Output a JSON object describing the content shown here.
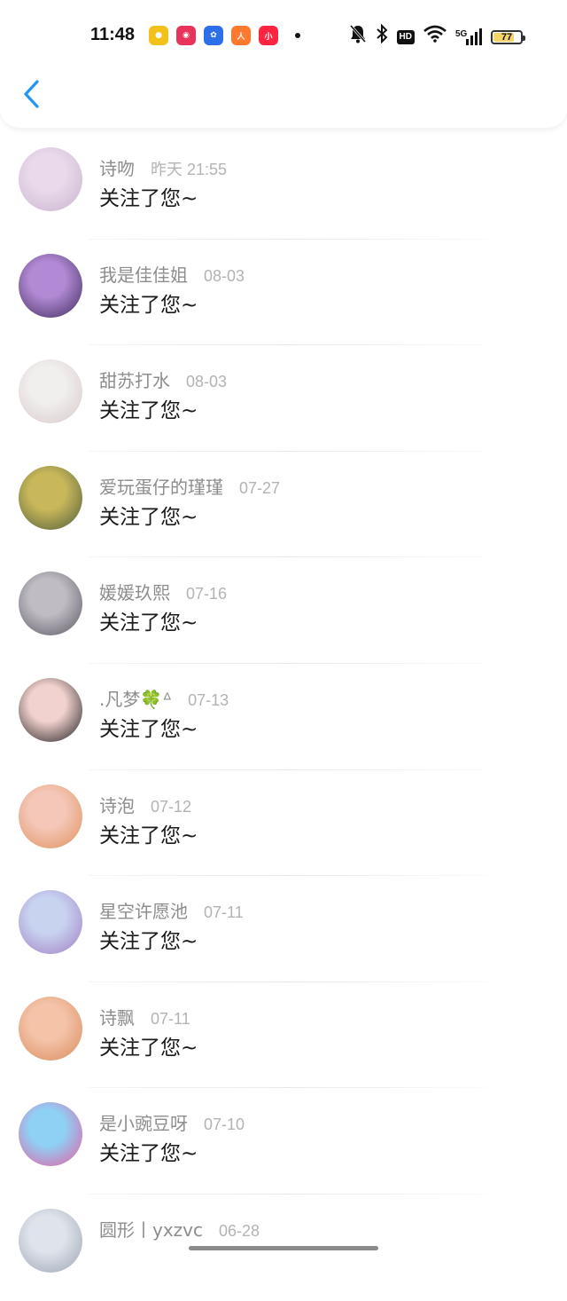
{
  "status_bar": {
    "time": "11:48",
    "battery": "77",
    "battery_level": 0.77,
    "network": "5G",
    "hd_label": "HD",
    "app_icons": [
      {
        "name": "app-icon-green",
        "color": "#f2c21b",
        "glyph": "●"
      },
      {
        "name": "app-icon-red-bird",
        "color": "#e8345a",
        "glyph": "◉"
      },
      {
        "name": "app-icon-baidu",
        "color": "#2d6fe8",
        "glyph": "✿"
      },
      {
        "name": "app-icon-orange",
        "color": "#ff7a2e",
        "glyph": "人"
      },
      {
        "name": "app-icon-xiaohongshu",
        "color": "#ff2442",
        "glyph": "小"
      }
    ]
  },
  "header": {
    "back_icon": "chevron-left-icon",
    "accent_color": "#2196f3"
  },
  "followers": [
    {
      "name": "诗吻",
      "time": "昨天 21:55",
      "message": "关注了您~",
      "avatar_colors": [
        "#e9d9ea",
        "#c9b3cf"
      ]
    },
    {
      "name": "我是佳佳姐",
      "time": "08-03",
      "message": "关注了您~",
      "avatar_colors": [
        "#b189d4",
        "#3d2a5a"
      ]
    },
    {
      "name": "甜苏打水",
      "time": "08-03",
      "message": "关注了您~",
      "avatar_colors": [
        "#f1eeee",
        "#d8c9c9"
      ]
    },
    {
      "name": "爱玩蛋仔的瑾瑾",
      "time": "07-27",
      "message": "关注了您~",
      "avatar_colors": [
        "#c9b85a",
        "#4d5a3a"
      ]
    },
    {
      "name": "媛媛玖熙",
      "time": "07-16",
      "message": "关注了您~",
      "avatar_colors": [
        "#bfbcc4",
        "#5a5762"
      ]
    },
    {
      "name": ".凡梦🍀ᐞ",
      "time": "07-13",
      "message": "关注了您~",
      "avatar_colors": [
        "#f2d2cf",
        "#1a1a1a"
      ]
    },
    {
      "name": "诗泡",
      "time": "07-12",
      "message": "关注了您~",
      "avatar_colors": [
        "#f4c7b8",
        "#e0905a"
      ]
    },
    {
      "name": "星空许愿池",
      "time": "07-11",
      "message": "关注了您~",
      "avatar_colors": [
        "#c8d3f0",
        "#a07cc2"
      ]
    },
    {
      "name": "诗飘",
      "time": "07-11",
      "message": "关注了您~",
      "avatar_colors": [
        "#f4c3a8",
        "#d98a5c"
      ]
    },
    {
      "name": "是小豌豆呀",
      "time": "07-10",
      "message": "关注了您~",
      "avatar_colors": [
        "#8fd0f5",
        "#e85aa0"
      ]
    },
    {
      "name": "圆形丨yxzvc",
      "time": "06-28",
      "message": "",
      "avatar_colors": [
        "#dfe3ea",
        "#9aa3b3"
      ]
    }
  ]
}
